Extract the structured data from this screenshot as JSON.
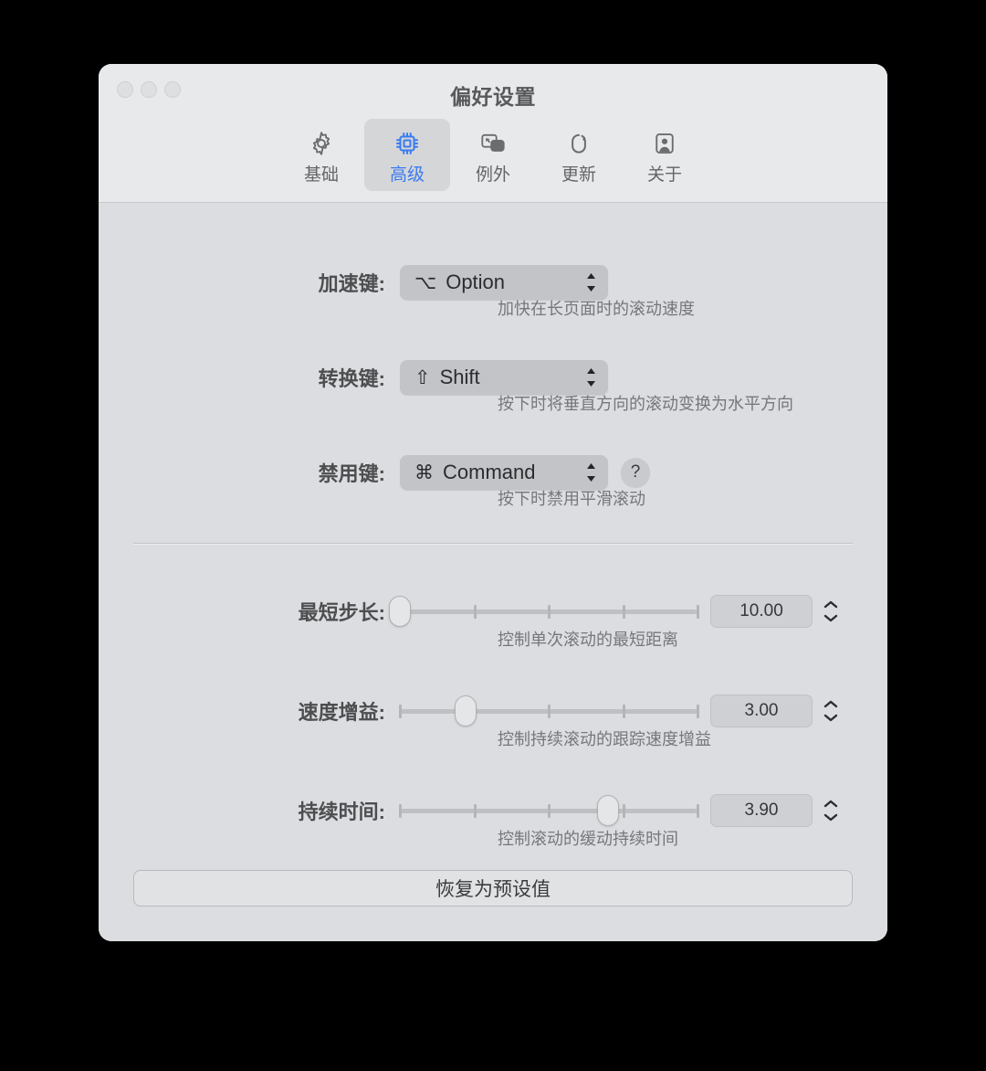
{
  "window": {
    "title": "偏好设置",
    "traffic_lights": [
      "close-button",
      "minimize-button",
      "zoom-button"
    ]
  },
  "toolbar": {
    "tabs": [
      {
        "label": "基础",
        "icon": "gear-icon",
        "active": false
      },
      {
        "label": "高级",
        "icon": "chip-icon",
        "active": true
      },
      {
        "label": "例外",
        "icon": "windows-overlap-icon",
        "active": false
      },
      {
        "label": "更新",
        "icon": "refresh-loop-icon",
        "active": false
      },
      {
        "label": "关于",
        "icon": "person-card-icon",
        "active": false
      }
    ],
    "active_color": "#3b7bf0",
    "inactive_color": "#646567"
  },
  "modifier_rows": [
    {
      "label": "加速键:",
      "value_symbol": "⌥",
      "value_text": "Option",
      "hint": "加快在长页面时的滚动速度",
      "has_help": false
    },
    {
      "label": "转换键:",
      "value_symbol": "⇧",
      "value_text": "Shift",
      "hint": "按下时将垂直方向的滚动变换为水平方向",
      "has_help": false
    },
    {
      "label": "禁用键:",
      "value_symbol": "⌘",
      "value_text": "Command",
      "hint": "按下时禁用平滑滚动",
      "has_help": true,
      "help_label": "?"
    }
  ],
  "slider_rows": [
    {
      "label": "最短步长:",
      "value": "10.00",
      "hint": "控制单次滚动的最短距离",
      "thumb_percent": 0,
      "ticks_percent": [
        0,
        25,
        50,
        75,
        100
      ]
    },
    {
      "label": "速度增益:",
      "value": "3.00",
      "hint": "控制持续滚动的跟踪速度增益",
      "thumb_percent": 22,
      "ticks_percent": [
        0,
        25,
        50,
        75,
        100
      ]
    },
    {
      "label": "持续时间:",
      "value": "3.90",
      "hint": "控制滚动的缓动持续时间",
      "thumb_percent": 70,
      "ticks_percent": [
        0,
        25,
        50,
        75,
        100
      ]
    }
  ],
  "reset_button": {
    "label": "恢复为预设值"
  }
}
